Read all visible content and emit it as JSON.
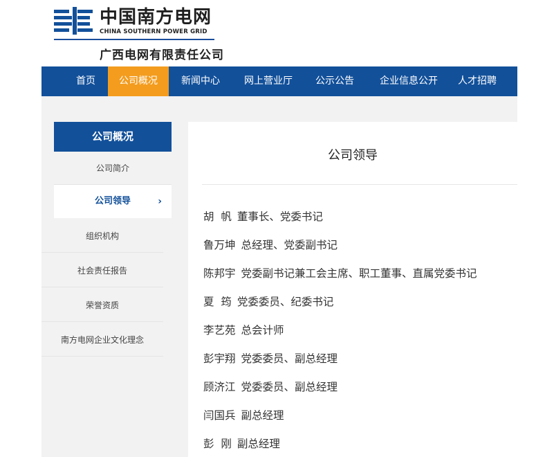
{
  "header": {
    "logo_cn": "中国南方电网",
    "logo_en": "CHINA SOUTHERN POWER GRID",
    "sub_company": "广西电网有限责任公司",
    "brand_color": "#12509a"
  },
  "nav": {
    "items": [
      {
        "label": "首页"
      },
      {
        "label": "公司概况",
        "active": true
      },
      {
        "label": "新闻中心"
      },
      {
        "label": "网上营业厅"
      },
      {
        "label": "公示公告"
      },
      {
        "label": "企业信息公开"
      },
      {
        "label": "人才招聘"
      }
    ],
    "active_color": "#f39c1e"
  },
  "sidebar": {
    "title": "公司概况",
    "items": [
      {
        "label": "公司简介"
      },
      {
        "label": "公司领导",
        "current": true
      },
      {
        "label": "组织机构"
      },
      {
        "label": "社会责任报告"
      },
      {
        "label": "荣誉资质"
      },
      {
        "label": "南方电网企业文化理念"
      }
    ],
    "chevron_icon": "chevron-right-icon"
  },
  "content": {
    "title": "公司领导",
    "leaders": [
      {
        "name": "胡  帆",
        "title": "董事长、党委书记"
      },
      {
        "name": "鲁万坤",
        "title": "总经理、党委副书记"
      },
      {
        "name": "陈邦宇",
        "title": "党委副书记兼工会主席、职工董事、直属党委书记"
      },
      {
        "name": "夏  筠",
        "title": "党委委员、纪委书记"
      },
      {
        "name": "李艺苑",
        "title": "总会计师"
      },
      {
        "name": "彭宇翔",
        "title": "党委委员、副总经理"
      },
      {
        "name": "顾济江",
        "title": "党委委员、副总经理"
      },
      {
        "name": "闫国兵",
        "title": "副总经理"
      },
      {
        "name": "彭  刚",
        "title": "副总经理"
      }
    ]
  }
}
